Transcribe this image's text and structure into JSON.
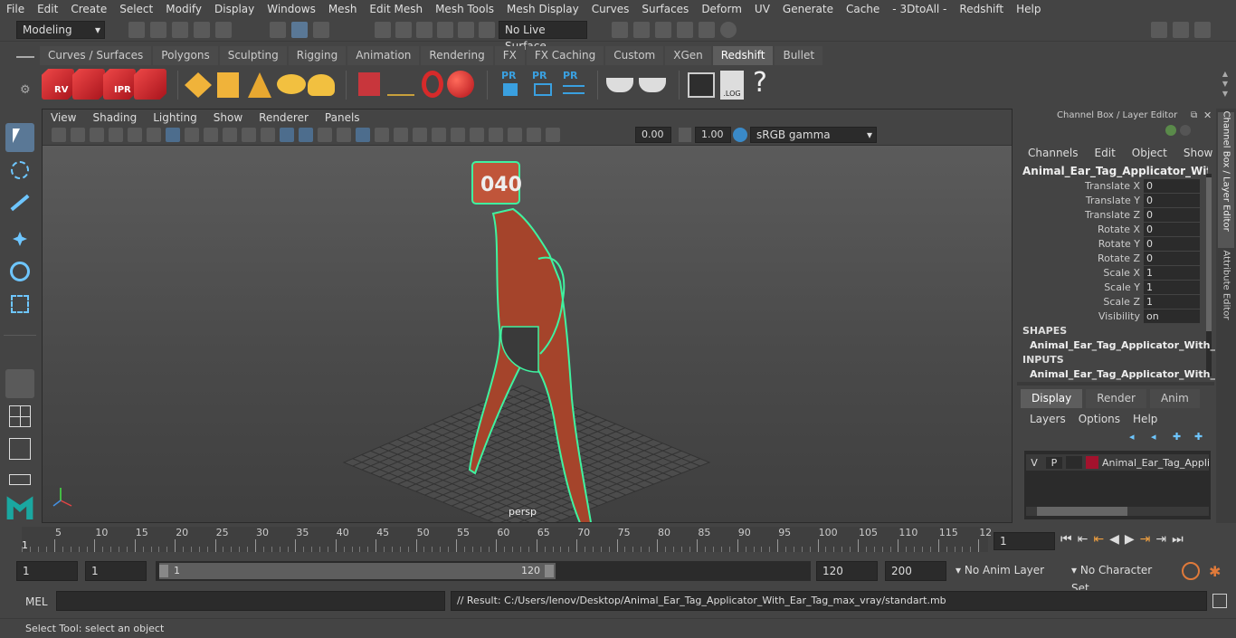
{
  "menubar": [
    "File",
    "Edit",
    "Create",
    "Select",
    "Modify",
    "Display",
    "Windows",
    "Mesh",
    "Edit Mesh",
    "Mesh Tools",
    "Mesh Display",
    "Curves",
    "Surfaces",
    "Deform",
    "UV",
    "Generate",
    "Cache",
    "- 3DtoAll -",
    "Redshift",
    "Help"
  ],
  "status": {
    "workspace": "Modeling",
    "live_surface": "No Live Surface"
  },
  "shelf_tabs": [
    "Curves / Surfaces",
    "Polygons",
    "Sculpting",
    "Rigging",
    "Animation",
    "Rendering",
    "FX",
    "FX Caching",
    "Custom",
    "XGen",
    "Redshift",
    "Bullet"
  ],
  "shelf_active": "Redshift",
  "shelf_icon_labels": {
    "rv": "RV",
    "ipr": "IPR",
    "pr": "PR",
    "log": ".LOG",
    "help": "?"
  },
  "viewport": {
    "menu": [
      "View",
      "Shading",
      "Lighting",
      "Show",
      "Renderer",
      "Panels"
    ],
    "exposure": "0.00",
    "gamma": "1.00",
    "colorspace": "sRGB gamma",
    "camera_label": "persp",
    "tag_number": "040"
  },
  "channelbox": {
    "title": "Channel Box / Layer Editor",
    "menu": [
      "Channels",
      "Edit",
      "Object",
      "Show"
    ],
    "object_name": "Animal_Ear_Tag_Applicator_With_Ea...",
    "channels": [
      {
        "label": "Translate X",
        "value": "0"
      },
      {
        "label": "Translate Y",
        "value": "0"
      },
      {
        "label": "Translate Z",
        "value": "0"
      },
      {
        "label": "Rotate X",
        "value": "0"
      },
      {
        "label": "Rotate Y",
        "value": "0"
      },
      {
        "label": "Rotate Z",
        "value": "0"
      },
      {
        "label": "Scale X",
        "value": "1"
      },
      {
        "label": "Scale Y",
        "value": "1"
      },
      {
        "label": "Scale Z",
        "value": "1"
      },
      {
        "label": "Visibility",
        "value": "on"
      }
    ],
    "shapes_header": "SHAPES",
    "shapes_item": "Animal_Ear_Tag_Applicator_With_...",
    "inputs_header": "INPUTS",
    "inputs_item": "Animal_Ear_Tag_Applicator_With_...",
    "layer_tabs": [
      "Display",
      "Render",
      "Anim"
    ],
    "layer_menu": [
      "Layers",
      "Options",
      "Help"
    ],
    "layer": {
      "v": "V",
      "p": "P",
      "name": "Animal_Ear_Tag_Applic",
      "color": "#a3122d"
    }
  },
  "side_tabs": [
    "Channel Box / Layer Editor",
    "Attribute Editor"
  ],
  "timeline": {
    "ticks": [
      "5",
      "10",
      "15",
      "20",
      "25",
      "30",
      "35",
      "40",
      "45",
      "50",
      "55",
      "60",
      "65",
      "70",
      "75",
      "80",
      "85",
      "90",
      "95",
      "100",
      "105",
      "110",
      "115",
      "12"
    ],
    "start_marker": "1",
    "current_frame": "1"
  },
  "range": {
    "start": "1",
    "playback_start": "1",
    "slider_start": "1",
    "slider_end": "120",
    "playback_end": "120",
    "end": "200",
    "anim_layer": "No Anim Layer",
    "character_set": "No Character Set"
  },
  "cmd": {
    "lang": "MEL",
    "result": "// Result: C:/Users/lenov/Desktop/Animal_Ear_Tag_Applicator_With_Ear_Tag_max_vray/standart.mb"
  },
  "help": "Select Tool: select an object",
  "colors": {
    "wire": "#3ff2a0",
    "body": "#b5442a",
    "redshift": "#d9282f",
    "active_tool": "#5a7896"
  }
}
